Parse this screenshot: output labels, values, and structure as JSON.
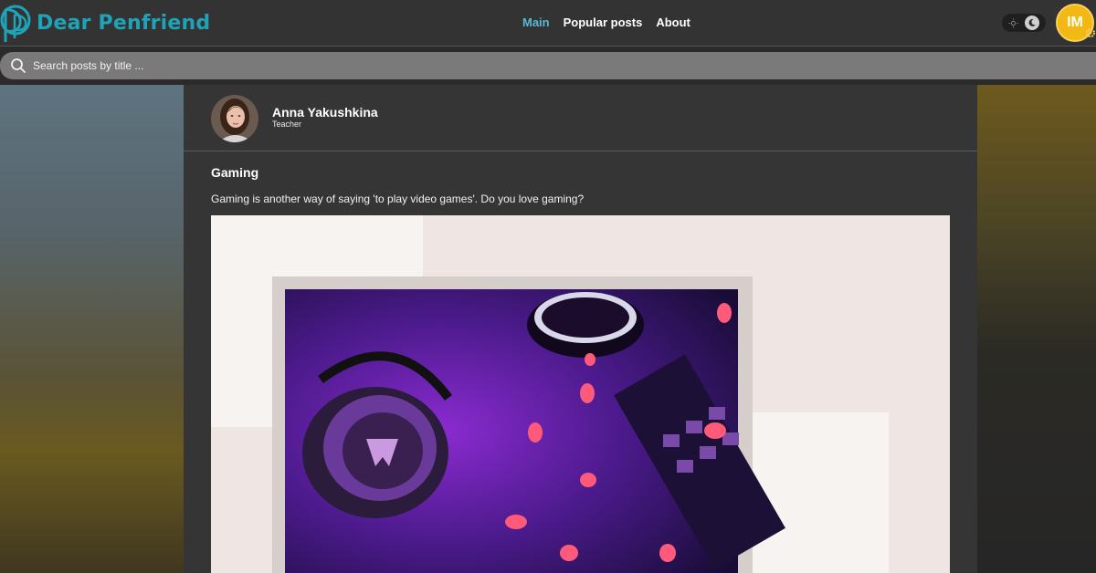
{
  "brand": {
    "name": "Dear Penfriend",
    "color": "#1fa3b8"
  },
  "nav": {
    "items": [
      {
        "label": "Main",
        "active": true
      },
      {
        "label": "Popular posts",
        "active": false
      },
      {
        "label": "About",
        "active": false
      }
    ]
  },
  "user": {
    "initials": "IM"
  },
  "search": {
    "placeholder": "Search posts by title ..."
  },
  "post": {
    "author_name": "Anna Yakushkina",
    "author_role": "Teacher",
    "title": "Gaming",
    "text": "Gaming is another way of saying 'to play video games'. Do you love gaming?"
  },
  "icons": [
    "logo-icon",
    "sun-icon",
    "moon-icon",
    "gear-icon",
    "search-icon"
  ]
}
